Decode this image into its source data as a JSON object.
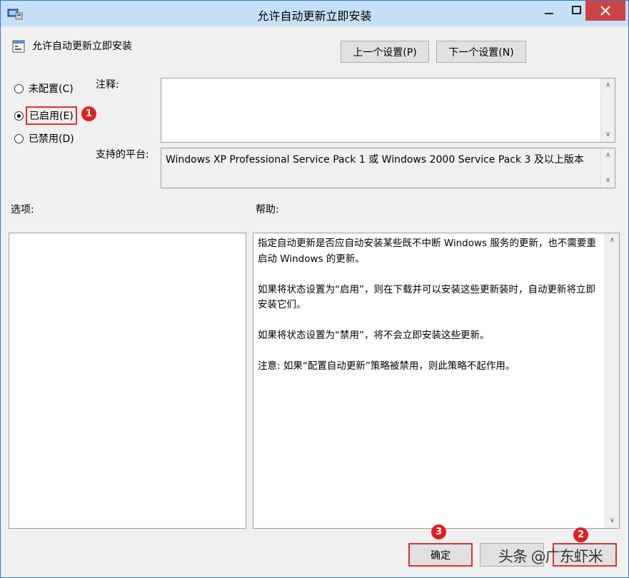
{
  "window": {
    "title": "允许自动更新立即安装",
    "minimize": "–",
    "maximize": "□",
    "close": "✕"
  },
  "policy": {
    "name": "允许自动更新立即安装",
    "prev_label": "上一个设置(P)",
    "next_label": "下一个设置(N)"
  },
  "options": {
    "not_configured": "未配置(C)",
    "enabled": "已启用(E)",
    "disabled": "已禁用(D)",
    "selected": "enabled"
  },
  "comment": {
    "label": "注释:",
    "value": ""
  },
  "platform": {
    "label": "支持的平台:",
    "value": "Windows XP Professional Service Pack 1 或 Windows 2000 Service Pack 3 及以上版本"
  },
  "sections": {
    "options_label": "选项:",
    "help_label": "帮助:"
  },
  "help": {
    "paragraphs": [
      "指定自动更新是否应自动安装某些既不中断 Windows 服务的更新，也不需要重启动 Windows 的更新。",
      "如果将状态设置为“启用”，则在下载并可以安装这些更新装时，自动更新将立即安装它们。",
      "如果将状态设置为“禁用”，将不会立即安装这些更新。",
      "注意: 如果“配置自动更新”策略被禁用，则此策略不起作用。"
    ]
  },
  "footer": {
    "ok_label": "确定",
    "cancel_label": "",
    "apply_label": ""
  },
  "annotations": {
    "badge1": "1",
    "badge2": "2",
    "badge3": "3",
    "watermark": "头条 @广东虾米"
  },
  "icons": {
    "title": "group-policy-icon",
    "policy": "policy-setting-icon"
  },
  "colors": {
    "titlebar": "#c6e0f7",
    "highlight": "#e03030",
    "window_border": "#2b7ad8"
  }
}
